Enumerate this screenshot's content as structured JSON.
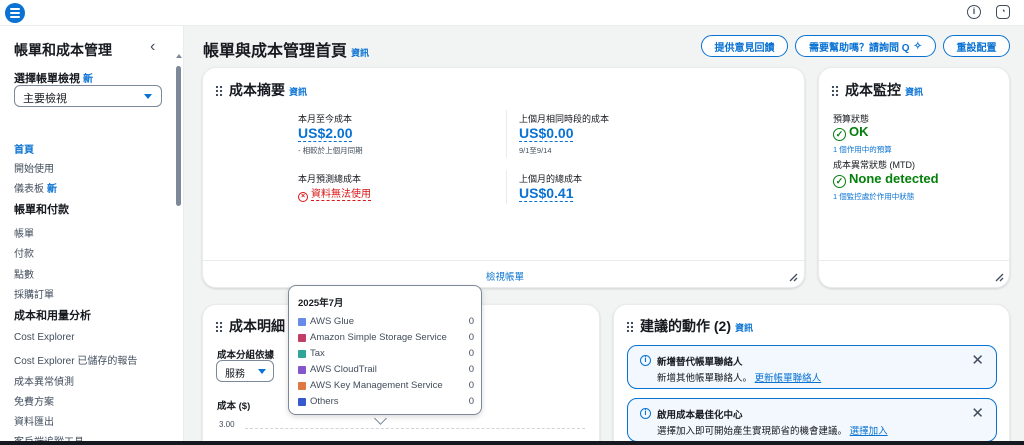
{
  "topbar": {
    "help_icon": "ⓘ",
    "settings_icon": "⚙"
  },
  "sidebar": {
    "title": "帳單和成本管理",
    "view_label": "選擇帳單檢視",
    "new_tag": "新",
    "view_selected": "主要檢視",
    "items": {
      "home": "首頁",
      "getting_started": "開始使用",
      "dashboard": "儀表板",
      "dashboard_new": "新",
      "billing_section": "帳單和付款",
      "bills": "帳單",
      "payments": "付款",
      "credits": "點數",
      "purchase_orders": "採購訂單",
      "cost_section": "成本和用量分析",
      "cost_explorer": "Cost Explorer",
      "saved_reports": "Cost Explorer 已儲存的報告",
      "anomaly": "成本異常偵測",
      "free_tier": "免費方案",
      "data_exports": "資料匯出",
      "customer_tags": "客戶端追蹤工具"
    }
  },
  "header": {
    "title": "帳單與成本管理首頁",
    "info": "資訊",
    "feedback_btn": "提供意見回饋",
    "help_btn": "需要幫助嗎？請詢問 Q",
    "reset_btn": "重設配置"
  },
  "cost_summary": {
    "title": "成本摘要",
    "info": "資訊",
    "mtd_label": "本月至今成本",
    "mtd_value": "US$2.00",
    "mtd_note": "- 相較於上個月同期",
    "last_same_label": "上個月相同時段的成本",
    "last_same_value": "US$0.00",
    "last_same_note": "9/1至9/14",
    "forecast_label": "本月預測總成本",
    "forecast_error": "資料無法使用",
    "last_total_label": "上個月的總成本",
    "last_total_value": "US$0.41",
    "footer_link": "檢視帳單"
  },
  "cost_monitor": {
    "title": "成本監控",
    "info": "資訊",
    "budget_label": "預算狀態",
    "budget_status": "OK",
    "budget_link": "1 個作用中的預算",
    "anomaly_label": "成本異常狀態 (MTD)",
    "anomaly_status": "None detected",
    "anomaly_link": "1 個監控處於作用中狀態"
  },
  "breakdown": {
    "title": "成本明細",
    "group_label": "成本分組依據",
    "group_value": "服務",
    "y_axis_label": "成本 ($)",
    "y_tick": "3.00"
  },
  "recommended": {
    "title": "建議的動作 (2)",
    "info": "資訊",
    "alerts": [
      {
        "title": "新增替代帳單聯絡人",
        "body": "新增其他帳單聯絡人。",
        "link": "更新帳單聯絡人"
      },
      {
        "title": "啟用成本最佳化中心",
        "body": "選擇加入即可開始產生實現節省的機會建議。",
        "link": "選擇加入"
      }
    ]
  },
  "tooltip": {
    "title": "2025年7月",
    "rows": [
      {
        "name": "AWS Glue",
        "value": "0",
        "color": "#688ae8"
      },
      {
        "name": "Amazon Simple Storage Service",
        "value": "0",
        "color": "#c33d69"
      },
      {
        "name": "Tax",
        "value": "0",
        "color": "#2ea597"
      },
      {
        "name": "AWS CloudTrail",
        "value": "0",
        "color": "#8456ce"
      },
      {
        "name": "AWS Key Management Service",
        "value": "0",
        "color": "#e07941"
      },
      {
        "name": "Others",
        "value": "0",
        "color": "#3759ce"
      }
    ]
  }
}
